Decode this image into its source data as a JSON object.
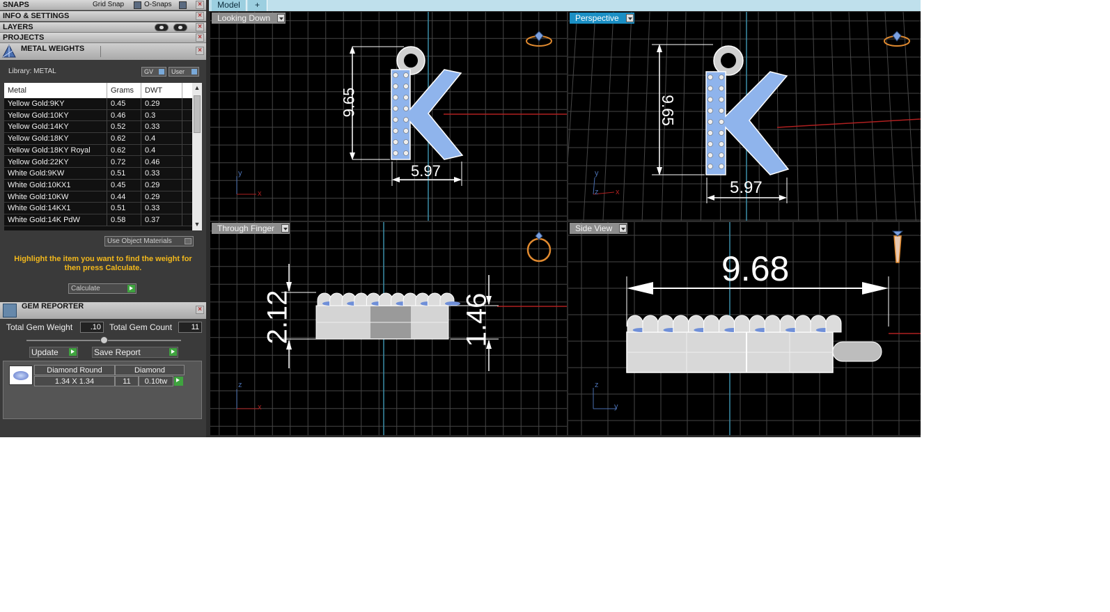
{
  "panels": {
    "snaps": {
      "label": "SNAPS",
      "grid_snap": "Grid Snap",
      "o_snaps": "O-Snaps"
    },
    "info": {
      "label": "INFO & SETTINGS"
    },
    "layers": {
      "label": "LAYERS"
    },
    "projects": {
      "label": "PROJECTS"
    }
  },
  "metal_weights": {
    "title": "METAL WEIGHTS",
    "library": "Library: METAL",
    "gv_label": "GV",
    "user_label": "User",
    "columns": [
      "Metal",
      "Grams",
      "DWT"
    ],
    "rows": [
      {
        "metal": "Yellow Gold:9KY",
        "grams": "0.45",
        "dwt": "0.29"
      },
      {
        "metal": "Yellow Gold:10KY",
        "grams": "0.46",
        "dwt": "0.3"
      },
      {
        "metal": "Yellow Gold:14KY",
        "grams": "0.52",
        "dwt": "0.33"
      },
      {
        "metal": "Yellow Gold:18KY",
        "grams": "0.62",
        "dwt": "0.4"
      },
      {
        "metal": "Yellow Gold:18KY Royal",
        "grams": "0.62",
        "dwt": "0.4"
      },
      {
        "metal": "Yellow Gold:22KY",
        "grams": "0.72",
        "dwt": "0.46"
      },
      {
        "metal": "White Gold:9KW",
        "grams": "0.51",
        "dwt": "0.33"
      },
      {
        "metal": "White Gold:10KX1",
        "grams": "0.45",
        "dwt": "0.29"
      },
      {
        "metal": "White Gold:10KW",
        "grams": "0.44",
        "dwt": "0.29"
      },
      {
        "metal": "White Gold:14KX1",
        "grams": "0.51",
        "dwt": "0.33"
      },
      {
        "metal": "White Gold:14K PdW",
        "grams": "0.58",
        "dwt": "0.37"
      }
    ],
    "use_object_materials": "Use Object Materials",
    "hint": "Highlight the item you want to find the weight for then press Calculate.",
    "calculate": "Calculate"
  },
  "gem_reporter": {
    "title": "GEM REPORTER",
    "total_weight_label": "Total Gem Weight",
    "total_weight": ".10",
    "total_count_label": "Total Gem Count",
    "total_count": "11",
    "update": "Update",
    "save_report": "Save Report",
    "gem": {
      "shape": "Diamond Round",
      "type": "Diamond",
      "size": "1.34 X 1.34",
      "count": "11",
      "weight": "0.10tw"
    }
  },
  "tabs": [
    {
      "label": "Model"
    },
    {
      "label": "+"
    }
  ],
  "viewports": {
    "top": {
      "label": "Looking Down",
      "dim_height": "9.65",
      "dim_width": "5.97",
      "axis_v": "y",
      "axis_h": "x"
    },
    "perspective": {
      "label": "Perspective",
      "dim_height": "9.65",
      "dim_width": "5.97",
      "axis_v": "y",
      "axis_h": "x",
      "axis_z": "z"
    },
    "front": {
      "label": "Through Finger",
      "dim_left": "2.12",
      "dim_right": "1.46",
      "axis_v": "z",
      "axis_h": "x"
    },
    "side": {
      "label": "Side View",
      "dim_length": "9.68",
      "axis_v": "z",
      "axis_h": "y"
    }
  },
  "colors": {
    "stone": "#8fb4ec",
    "metal": "#c9c9c9",
    "grid": "#3c3c3c",
    "accent": "#1b8fc4",
    "hint": "#f2b81c"
  }
}
